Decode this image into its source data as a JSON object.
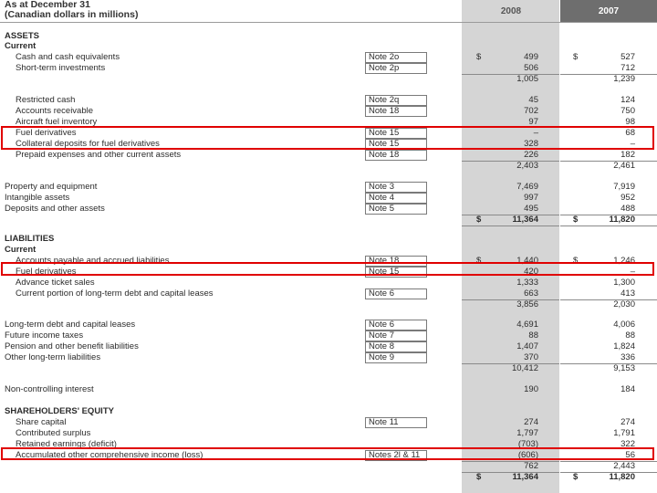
{
  "header": {
    "title_line1": "As at December 31",
    "title_line2": "(Canadian dollars in millions)",
    "year_2008": "2008",
    "year_2007": "2007"
  },
  "rows": [
    {
      "label": "ASSETS",
      "section": true
    },
    {
      "label": "Current",
      "section": true
    },
    {
      "label": "Cash and cash equivalents",
      "indent": true,
      "note": "Note 2o",
      "cur08": "$",
      "v08": "499",
      "cur07": "$",
      "v07": "527"
    },
    {
      "label": "Short-term investments",
      "indent": true,
      "note": "Note 2p",
      "v08": "506",
      "v07": "712"
    },
    {
      "label": "",
      "v08": "1,005",
      "v07": "1,239"
    },
    {
      "label": "Restricted cash",
      "indent": true,
      "note": "Note 2q",
      "v08": "45",
      "v07": "124"
    },
    {
      "label": "Accounts receivable",
      "indent": true,
      "note": "Note 18",
      "v08": "702",
      "v07": "750"
    },
    {
      "label": "Aircraft fuel inventory",
      "indent": true,
      "v08": "97",
      "v07": "98"
    },
    {
      "label": "Fuel derivatives",
      "indent": true,
      "note": "Note 15",
      "v08": "–",
      "v07": "68"
    },
    {
      "label": "Collateral deposits for fuel derivatives",
      "indent": true,
      "note": "Note 15",
      "v08": "328",
      "v07": "–"
    },
    {
      "label": "Prepaid expenses and other current assets",
      "indent": true,
      "note": "Note 18",
      "v08": "226",
      "v07": "182"
    },
    {
      "label": "",
      "v08": "2,403",
      "v07": "2,461"
    },
    {
      "label": "Property and equipment",
      "note": "Note 3",
      "v08": "7,469",
      "v07": "7,919"
    },
    {
      "label": "Intangible assets",
      "note": "Note 4",
      "v08": "997",
      "v07": "952"
    },
    {
      "label": "Deposits and other assets",
      "note": "Note 5",
      "v08": "495",
      "v07": "488"
    },
    {
      "label": "",
      "total": true,
      "cur08": "$",
      "v08": "11,364",
      "cur07": "$",
      "v07": "11,820"
    },
    {
      "label": "LIABILITIES",
      "section": true
    },
    {
      "label": "Current",
      "section": true
    },
    {
      "label": "Accounts payable and accrued liabilities",
      "indent": true,
      "note": "Note 18",
      "cur08": "$",
      "v08": "1,440",
      "cur07": "$",
      "v07": "1,246"
    },
    {
      "label": "Fuel derivatives",
      "indent": true,
      "note": "Note 15",
      "v08": "420",
      "v07": "–"
    },
    {
      "label": "Advance ticket sales",
      "indent": true,
      "v08": "1,333",
      "v07": "1,300"
    },
    {
      "label": "Current portion of long-term debt and capital leases",
      "indent": true,
      "note": "Note 6",
      "v08": "663",
      "v07": "413"
    },
    {
      "label": "",
      "v08": "3,856",
      "v07": "2,030"
    },
    {
      "label": "Long-term debt and capital leases",
      "note": "Note 6",
      "v08": "4,691",
      "v07": "4,006"
    },
    {
      "label": "Future income taxes",
      "note": "Note 7",
      "v08": "88",
      "v07": "88"
    },
    {
      "label": "Pension and other benefit liabilities",
      "note": "Note 8",
      "v08": "1,407",
      "v07": "1,824"
    },
    {
      "label": "Other long-term liabilities",
      "note": "Note 9",
      "v08": "370",
      "v07": "336"
    },
    {
      "label": "",
      "v08": "10,412",
      "v07": "9,153"
    },
    {
      "label": "Non-controlling interest",
      "v08": "190",
      "v07": "184"
    },
    {
      "label": "SHAREHOLDERS' EQUITY",
      "section": true
    },
    {
      "label": "Share capital",
      "indent": true,
      "note": "Note 11",
      "v08": "274",
      "v07": "274"
    },
    {
      "label": "Contributed surplus",
      "indent": true,
      "v08": "1,797",
      "v07": "1,791"
    },
    {
      "label": "Retained earnings (deficit)",
      "indent": true,
      "v08": "(703)",
      "v07": "322"
    },
    {
      "label": "Accumulated other comprehensive income (loss)",
      "indent": true,
      "note": "Notes 2l & 11",
      "v08": "(606)",
      "v07": "56"
    },
    {
      "label": "",
      "v08": "762",
      "v07": "2,443"
    },
    {
      "label": "",
      "total": true,
      "cur08": "$",
      "v08": "11,364",
      "cur07": "$",
      "v07": "11,820"
    }
  ],
  "highlight_color": "#e00000"
}
